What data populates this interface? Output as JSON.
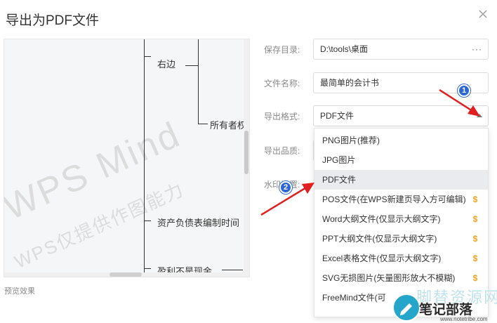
{
  "dialog": {
    "title": "导出为PDF文件"
  },
  "preview": {
    "watermark_main": "WPS Mind",
    "watermark_sub": "WPS仅提供作图能力",
    "nodes": [
      "右边",
      "所有者权",
      "资产负债表编制时间",
      "盈利不是现金"
    ],
    "label": "预览效果"
  },
  "form": {
    "save_dir_label": "保存目录:",
    "save_dir_value": "D:\\tools\\桌面",
    "browse_label": "···",
    "filename_label": "文件名称:",
    "filename_value": "最简单的会计书",
    "format_label": "导出格式:",
    "format_value": "PDF文件",
    "quality_label": "导出品质:",
    "watermark_label": "水印设置:"
  },
  "dropdown": {
    "options": [
      {
        "label": "PNG图片(推荐)",
        "premium": false
      },
      {
        "label": "JPG图片",
        "premium": false
      },
      {
        "label": "PDF文件",
        "premium": false,
        "selected": true
      },
      {
        "label": "POS文件(在WPS新建页导入方可编辑)",
        "premium": true
      },
      {
        "label": "Word大纲文件(仅显示大纲文字)",
        "premium": true
      },
      {
        "label": "PPT大纲文件(仅显示大纲文字)",
        "premium": true
      },
      {
        "label": "Excel表格文件(仅显示大纲文字)",
        "premium": true
      },
      {
        "label": "SVG无损图片(矢量图形放大不模糊)",
        "premium": true
      },
      {
        "label": "FreeMind文件(可",
        "premium": false
      }
    ],
    "coin_symbol": "$"
  },
  "annotations": {
    "badge1": "1",
    "badge2": "2"
  },
  "site_logo": {
    "watermark": "脚替资源网",
    "brand": "笔记部落",
    "url": "www.notetribe.com"
  },
  "colors": {
    "accent": "#2c66d3",
    "arrow": "#e02020",
    "coin": "#f3a21c",
    "selected_bg": "#e9ebee"
  }
}
